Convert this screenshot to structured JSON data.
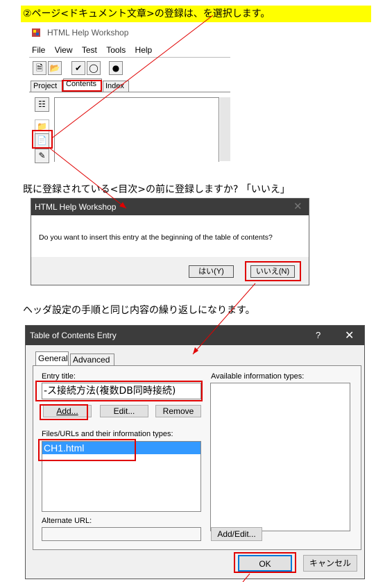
{
  "step1": {
    "text": "②ページ<ドキュメント文章>の登録は、を選択します。"
  },
  "hhw": {
    "title": "HTML Help Workshop",
    "menu": [
      "File",
      "View",
      "Test",
      "Tools",
      "Help"
    ],
    "tabs": [
      "Project",
      "Contents",
      "Index"
    ]
  },
  "para2": "既に登録されている<目次>の前に登録しますか? 「いいえ」",
  "dialog1": {
    "title": "HTML Help Workshop",
    "message": "Do you want to insert this entry at the beginning of the table of contents?",
    "yes_label": "はい(Y)",
    "no_label": "いいえ(N)"
  },
  "para3": "ヘッダ設定の手順と同じ内容の繰り返しになります。",
  "toc": {
    "title": "Table of Contents Entry",
    "help_label": "?",
    "tabs": [
      "General",
      "Advanced"
    ],
    "entry_title_label": "Entry title:",
    "entry_title_value": "-ス接続方法(複数DB同時接続)",
    "available_label": "Available information types:",
    "add_label": "Add...",
    "edit_label": "Edit...",
    "remove_label": "Remove",
    "files_label": "Files/URLs and their information types:",
    "files": [
      "CH1.html"
    ],
    "alternate_label": "Alternate URL:",
    "alternate_value": "",
    "addedit_label": "Add/Edit...",
    "ok_label": "OK",
    "cancel_label": "キャンセル"
  }
}
